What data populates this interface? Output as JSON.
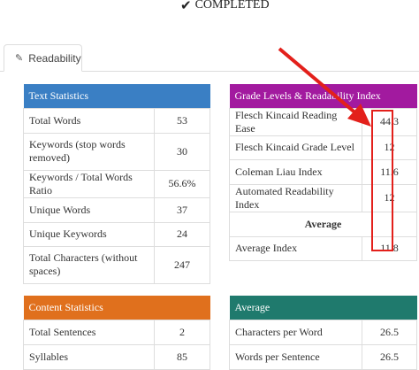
{
  "status": {
    "icon": "check-icon",
    "label": "COMPLETED"
  },
  "tab": {
    "icon": "pencil-icon",
    "label": "Readability"
  },
  "text_statistics": {
    "title": "Text Statistics",
    "rows": [
      {
        "label": "Total Words",
        "value": "53"
      },
      {
        "label": "Keywords (stop words removed)",
        "value": "30"
      },
      {
        "label": "Keywords / Total Words Ratio",
        "value": "56.6%"
      },
      {
        "label": "Unique Words",
        "value": "37"
      },
      {
        "label": "Unique Keywords",
        "value": "24"
      },
      {
        "label": "Total Characters (without spaces)",
        "value": "247"
      }
    ]
  },
  "grade_levels": {
    "title": "Grade Levels & Readability Index",
    "rows": [
      {
        "label": "Flesch Kincaid Reading Ease",
        "value": "44.3"
      },
      {
        "label": "Flesch Kincaid Grade Level",
        "value": "12"
      },
      {
        "label": "Coleman Liau Index",
        "value": "11.6"
      },
      {
        "label": "Automated Readability Index",
        "value": "12"
      }
    ],
    "average_heading": "Average",
    "average_row": {
      "label": "Average Index",
      "value": "11.8"
    }
  },
  "content_statistics": {
    "title": "Content Statistics",
    "rows": [
      {
        "label": "Total Sentences",
        "value": "2"
      },
      {
        "label": "Syllables",
        "value": "85"
      }
    ]
  },
  "average_table": {
    "title": "Average",
    "rows": [
      {
        "label": "Characters per Word",
        "value": "26.5"
      },
      {
        "label": "Words per Sentence",
        "value": "26.5"
      }
    ]
  },
  "colors": {
    "text_statistics": "#3a7fc4",
    "grade_levels": "#a21a9f",
    "content_statistics": "#e0701d",
    "average": "#1f7a6d",
    "annotation": "#e3201b"
  }
}
